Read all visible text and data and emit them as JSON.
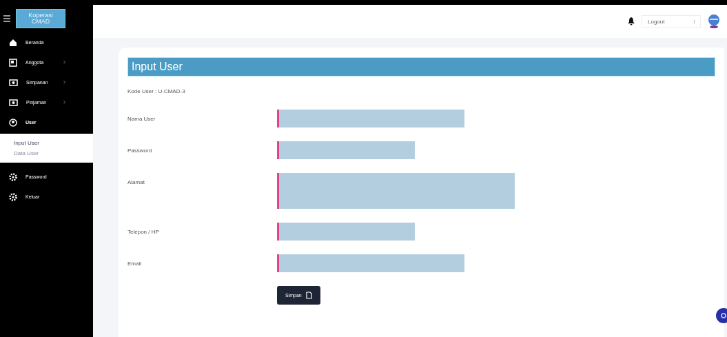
{
  "sidebar": {
    "logo": "Koperasi CMAD",
    "items": [
      {
        "label": "Beranda",
        "selected": false
      },
      {
        "label": "Anggota",
        "selected": false
      },
      {
        "label": "Simpanan",
        "selected": false
      },
      {
        "label": "Pinjaman",
        "selected": false
      },
      {
        "label": "User",
        "selected": true,
        "children": [
          {
            "label": "Input User",
            "selected": true
          },
          {
            "label": "Data User",
            "selected": false
          }
        ]
      },
      {
        "label": "Password",
        "selected": false
      },
      {
        "label": "Keluar",
        "selected": false
      }
    ]
  },
  "header": {
    "dropdown": "Logout"
  },
  "form": {
    "title": "Input User",
    "code": "Kode User : U-CMAD-3",
    "fields": [
      {
        "label": "Nama User",
        "kind": "text"
      },
      {
        "label": "Password",
        "kind": "text"
      },
      {
        "label": "Alamat",
        "kind": "textarea"
      },
      {
        "label": "Telepon / HP",
        "kind": "text"
      },
      {
        "label": "Email",
        "kind": "text"
      }
    ],
    "submit": "Simpan"
  }
}
